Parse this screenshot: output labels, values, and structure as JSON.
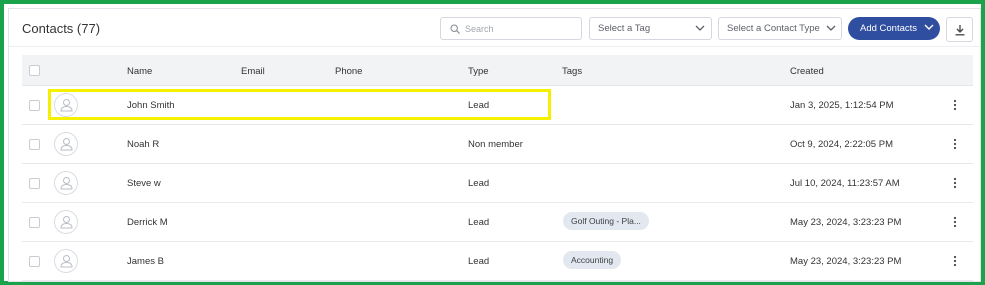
{
  "header": {
    "title": "Contacts (77)",
    "search_placeholder": "Search",
    "tag_select": "Select a Tag",
    "type_select": "Select a Contact Type",
    "add_button": "Add Contacts"
  },
  "table": {
    "columns": [
      "Name",
      "Email",
      "Phone",
      "Type",
      "Tags",
      "Created"
    ],
    "rows": [
      {
        "name": "John Smith",
        "email": "",
        "phone": "",
        "type": "Lead",
        "tag": "",
        "created": "Jan 3, 2025, 1:12:54 PM"
      },
      {
        "name": "Noah R",
        "email": "",
        "phone": "",
        "type": "Non member",
        "tag": "",
        "created": "Oct 9, 2024, 2:22:05 PM"
      },
      {
        "name": "Steve w",
        "email": "",
        "phone": "",
        "type": "Lead",
        "tag": "",
        "created": "Jul 10, 2024, 11:23:57 AM"
      },
      {
        "name": "Derrick M",
        "email": "",
        "phone": "",
        "type": "Lead",
        "tag": "Golf Outing - Pla...",
        "created": "May 23, 2024, 3:23:23 PM"
      },
      {
        "name": "James B",
        "email": "",
        "phone": "",
        "type": "Lead",
        "tag": "Accounting",
        "created": "May 23, 2024, 3:23:23 PM"
      }
    ]
  },
  "icons": {
    "search": "search-icon",
    "chevron": "chevron-down-icon",
    "download": "download-icon",
    "avatar": "user-icon",
    "more": "more-vertical-icon"
  },
  "colors": {
    "frame_border": "#1aa34a",
    "primary": "#2f4ea0",
    "highlight": "#f4f000",
    "tag_bg": "#e3e7ef"
  }
}
